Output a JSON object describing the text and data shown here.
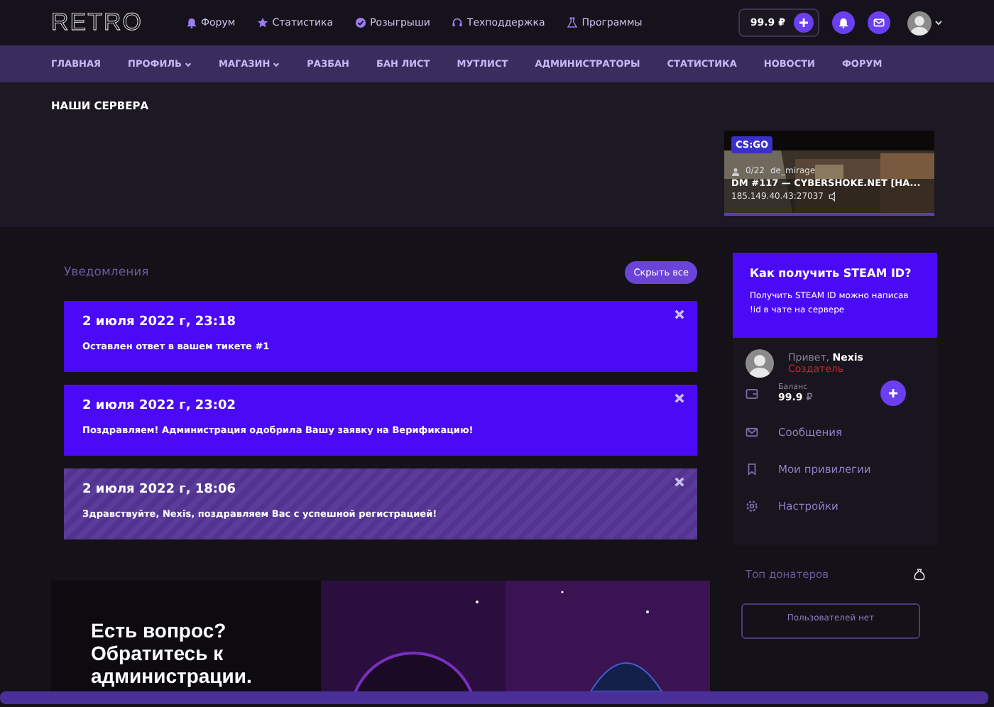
{
  "header": {
    "logo": "RETRO",
    "links": [
      {
        "label": "Форум"
      },
      {
        "label": "Статистика"
      },
      {
        "label": "Розыгрыши"
      },
      {
        "label": "Техподдержка"
      },
      {
        "label": "Программы"
      }
    ],
    "balance": "99.9 ₽"
  },
  "nav": [
    {
      "label": "ГЛАВНАЯ",
      "dropdown": false
    },
    {
      "label": "ПРОФИЛЬ",
      "dropdown": true
    },
    {
      "label": "МАГАЗИН",
      "dropdown": true
    },
    {
      "label": "РАЗБАН",
      "dropdown": false
    },
    {
      "label": "БАН ЛИСТ",
      "dropdown": false
    },
    {
      "label": "МУТЛИСТ",
      "dropdown": false
    },
    {
      "label": "АДМИНИСТРАТОРЫ",
      "dropdown": false
    },
    {
      "label": "СТАТИСТИКА",
      "dropdown": false
    },
    {
      "label": "НОВОСТИ",
      "dropdown": false
    },
    {
      "label": "ФОРУМ",
      "dropdown": false
    }
  ],
  "servers": {
    "title": "НАШИ СЕРВЕРА",
    "cards": [
      {
        "game": "CS:GO",
        "players": "0/22",
        "map": "de_mirage",
        "name": "DM #117 — CYBERSHOKE.NET [HA...",
        "address": "185.149.40.43:27037"
      }
    ]
  },
  "notifications": {
    "title": "Уведомления",
    "hide_all": "Скрыть все",
    "items": [
      {
        "date": "2 июля 2022 г, 23:18",
        "text": "Оставлен ответ в вашем тикете #1",
        "read": false
      },
      {
        "date": "2 июля 2022 г, 23:02",
        "text": "Поздравляем! Администрация одобрила Вашу заявку на Верификацию!",
        "read": false
      },
      {
        "date": "2 июля 2022 г, 18:06",
        "text": "Здравствуйте, Nexis, поздравляем Вас с успешной регистрацией!",
        "read": true
      }
    ]
  },
  "banner": {
    "heading": "Есть вопрос? Обратитесь к администрации."
  },
  "steam_card": {
    "title": "Как получить STEAM ID?",
    "text": "Получить STEAM ID можно написав !id в чате на сервере"
  },
  "user_panel": {
    "greeting": "Привет, **Nexis**",
    "role": "Создатель",
    "balance_label": "Баланс",
    "balance": "99.9",
    "currency": "₽",
    "menu": [
      {
        "label": "Сообщения"
      },
      {
        "label": "Мои привилегии"
      },
      {
        "label": "Настройки"
      }
    ]
  },
  "top_donators": {
    "title": "Топ донатеров",
    "empty": "Пользователей нет"
  }
}
